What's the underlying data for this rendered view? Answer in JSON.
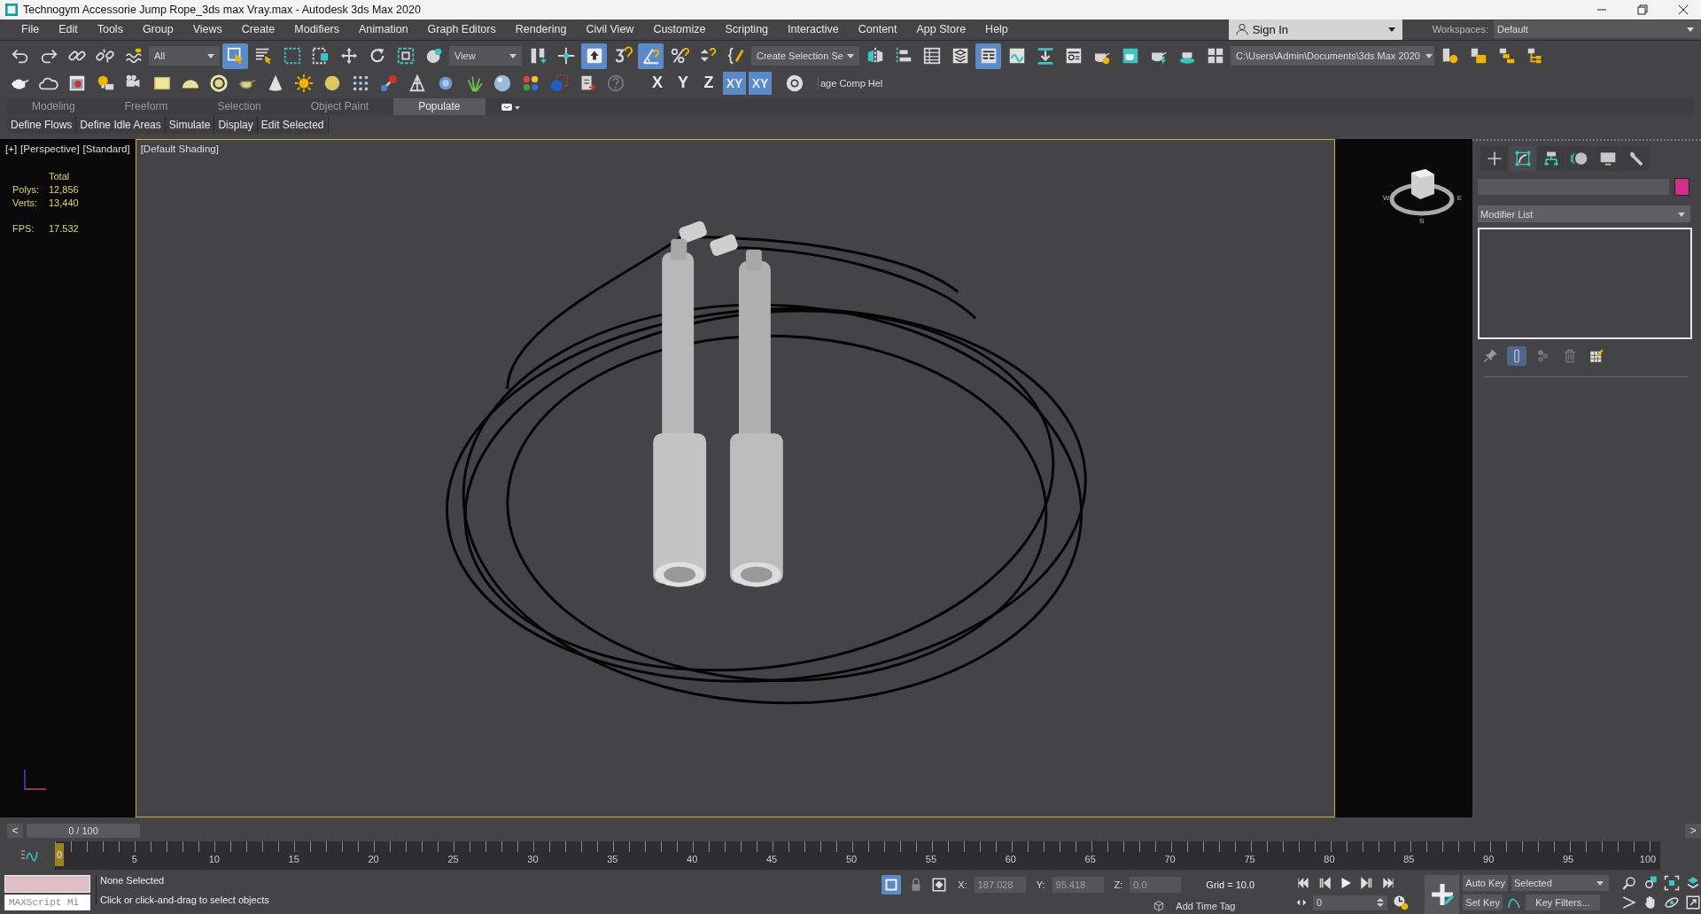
{
  "window": {
    "title": "Technogym Accessorie Jump Rope_3ds max Vray.max - Autodesk 3ds Max 2020"
  },
  "menu": [
    "File",
    "Edit",
    "Tools",
    "Group",
    "Views",
    "Create",
    "Modifiers",
    "Animation",
    "Graph Editors",
    "Rendering",
    "Civil View",
    "Customize",
    "Scripting",
    "Interactive",
    "Content",
    "App Store",
    "Help"
  ],
  "account": {
    "sign_in": "Sign In",
    "workspaces_label": "Workspaces:",
    "workspace": "Default"
  },
  "main_toolbar": [
    {
      "kind": "undo",
      "selected": false
    },
    {
      "kind": "redo",
      "selected": false
    },
    {
      "kind": "chain",
      "selected": false
    },
    {
      "kind": "broken-chain",
      "selected": false
    },
    {
      "kind": "squiggle",
      "selected": false
    },
    {
      "kind": "filter-dropdown",
      "value": "All",
      "selected": false
    },
    {
      "kind": "cursor-square",
      "selected": true
    },
    {
      "kind": "list-cursor",
      "selected": false
    },
    {
      "kind": "dashed-square",
      "selected": false
    },
    {
      "kind": "dashed-square-fill",
      "selected": false
    },
    {
      "kind": "move",
      "selected": false
    },
    {
      "kind": "rotate",
      "selected": false
    },
    {
      "kind": "scale",
      "selected": false
    },
    {
      "kind": "globe",
      "selected": false
    },
    {
      "kind": "coord-dropdown",
      "value": "View",
      "selected": false
    },
    {
      "kind": "pivot",
      "selected": false
    },
    {
      "kind": "crosshair",
      "selected": false
    },
    {
      "kind": "arrow-box",
      "selected": true
    },
    {
      "kind": "snap",
      "selected": false
    },
    {
      "kind": "angle",
      "selected": true
    },
    {
      "kind": "percent",
      "selected": false
    },
    {
      "kind": "spinner",
      "selected": false
    },
    {
      "kind": "braces",
      "selected": false
    },
    {
      "kind": "selection-dropdown",
      "value": "Create Selection Se",
      "selected": false
    },
    {
      "kind": "mirror",
      "selected": false
    },
    {
      "kind": "align",
      "selected": false
    },
    {
      "kind": "table",
      "selected": false
    },
    {
      "kind": "layers",
      "selected": false
    },
    {
      "kind": "panel",
      "selected": true
    },
    {
      "kind": "curve-window",
      "selected": false
    },
    {
      "kind": "down-bar",
      "selected": false
    },
    {
      "kind": "window-list",
      "selected": false
    },
    {
      "kind": "teapot-gear",
      "selected": false
    },
    {
      "kind": "teapot-window",
      "selected": false
    },
    {
      "kind": "teapot-bolt",
      "selected": false
    },
    {
      "kind": "teapot-cloud",
      "selected": false
    },
    {
      "kind": "quad",
      "selected": false
    },
    {
      "kind": "path-dropdown",
      "value": "C:\\Users\\Admin\\Documents\\3ds Max 2020",
      "selected": false
    },
    {
      "kind": "folder-gear",
      "selected": false
    },
    {
      "kind": "folder",
      "selected": false
    },
    {
      "kind": "folder-tree",
      "selected": false
    },
    {
      "kind": "folder-branch",
      "selected": false
    }
  ],
  "second_toolbar": [
    {
      "kind": "teapot"
    },
    {
      "kind": "cloud"
    },
    {
      "kind": "picture"
    },
    {
      "kind": "bulb"
    },
    {
      "kind": "camera"
    },
    {
      "kind": "rect"
    },
    {
      "kind": "dome"
    },
    {
      "kind": "ring"
    },
    {
      "kind": "teapot-outline"
    },
    {
      "kind": "cone"
    },
    {
      "kind": "sun"
    },
    {
      "kind": "ball"
    },
    {
      "kind": "dots"
    },
    {
      "kind": "bone"
    },
    {
      "kind": "tripod"
    },
    {
      "kind": "blob"
    },
    {
      "kind": "grass"
    },
    {
      "kind": "sphere"
    },
    {
      "kind": "color-balls"
    },
    {
      "kind": "ball-square"
    },
    {
      "kind": "clipboard"
    },
    {
      "kind": "help"
    }
  ],
  "axis_buttons": [
    {
      "label": "X",
      "selected": false
    },
    {
      "label": "Y",
      "selected": false
    },
    {
      "label": "Z",
      "selected": false
    },
    {
      "label": "XY",
      "selected": true
    },
    {
      "label": "XY",
      "selected": true
    }
  ],
  "cut_label": "age Comp Hel",
  "ribbon_tabs": [
    {
      "label": "Modeling",
      "selected": false
    },
    {
      "label": "Freeform",
      "selected": false
    },
    {
      "label": "Selection",
      "selected": false
    },
    {
      "label": "Object Paint",
      "selected": false
    },
    {
      "label": "Populate",
      "selected": true
    }
  ],
  "ribbon_panels": [
    "Define Flows",
    "Define Idle Areas",
    "Simulate",
    "Display",
    "Edit Selected"
  ],
  "viewport": {
    "labels": [
      "[+]",
      "[Perspective]",
      "[Standard]",
      "[Default Shading]"
    ],
    "stats_header": "Total",
    "stats": [
      {
        "label": "Polys:",
        "value": "12,856"
      },
      {
        "label": "Verts:",
        "value": "13,440"
      }
    ],
    "fps": {
      "label": "FPS:",
      "value": "17.532"
    },
    "compass": [
      "W",
      "E",
      "S"
    ]
  },
  "command_panel": {
    "tabs": [
      {
        "kind": "plus",
        "selected": false
      },
      {
        "kind": "curve-box",
        "selected": true
      },
      {
        "kind": "hierarchy",
        "selected": false
      },
      {
        "kind": "motion",
        "selected": false
      },
      {
        "kind": "monitor",
        "selected": false
      },
      {
        "kind": "wrench",
        "selected": false
      }
    ],
    "modifier_list": "Modifier List",
    "stack_tools": [
      {
        "kind": "pin",
        "selected": false
      },
      {
        "kind": "bar",
        "selected": true
      },
      {
        "kind": "balls",
        "selected": false
      },
      {
        "kind": "trash",
        "selected": false
      },
      {
        "kind": "grid-pencil",
        "selected": false
      }
    ]
  },
  "time_slider": {
    "prev": "<",
    "label": "0 / 100",
    "next": ">",
    "level": 0
  },
  "ruler": [
    "0",
    "5",
    "10",
    "15",
    "20",
    "25",
    "30",
    "35",
    "40",
    "45",
    "50",
    "55",
    "60",
    "65",
    "70",
    "75",
    "80",
    "85",
    "90",
    "95",
    "100"
  ],
  "status": {
    "listener_placeholder": "MAXScript Mi",
    "selection": "None Selected",
    "prompt": "Click or click-and-drag to select objects",
    "coords": [
      {
        "label": "X:",
        "value": "187.028",
        "disabled": true
      },
      {
        "label": "Y:",
        "value": "95.418",
        "disabled": true
      },
      {
        "label": "Z:",
        "value": "0.0",
        "disabled": true
      }
    ],
    "grid": "Grid = 10.0",
    "time_tag": "Add Time Tag",
    "frame": "0",
    "auto_key": "Auto Key",
    "key_mode": "Selected",
    "set_key": "Set Key",
    "key_filters": "Key Filters..."
  }
}
